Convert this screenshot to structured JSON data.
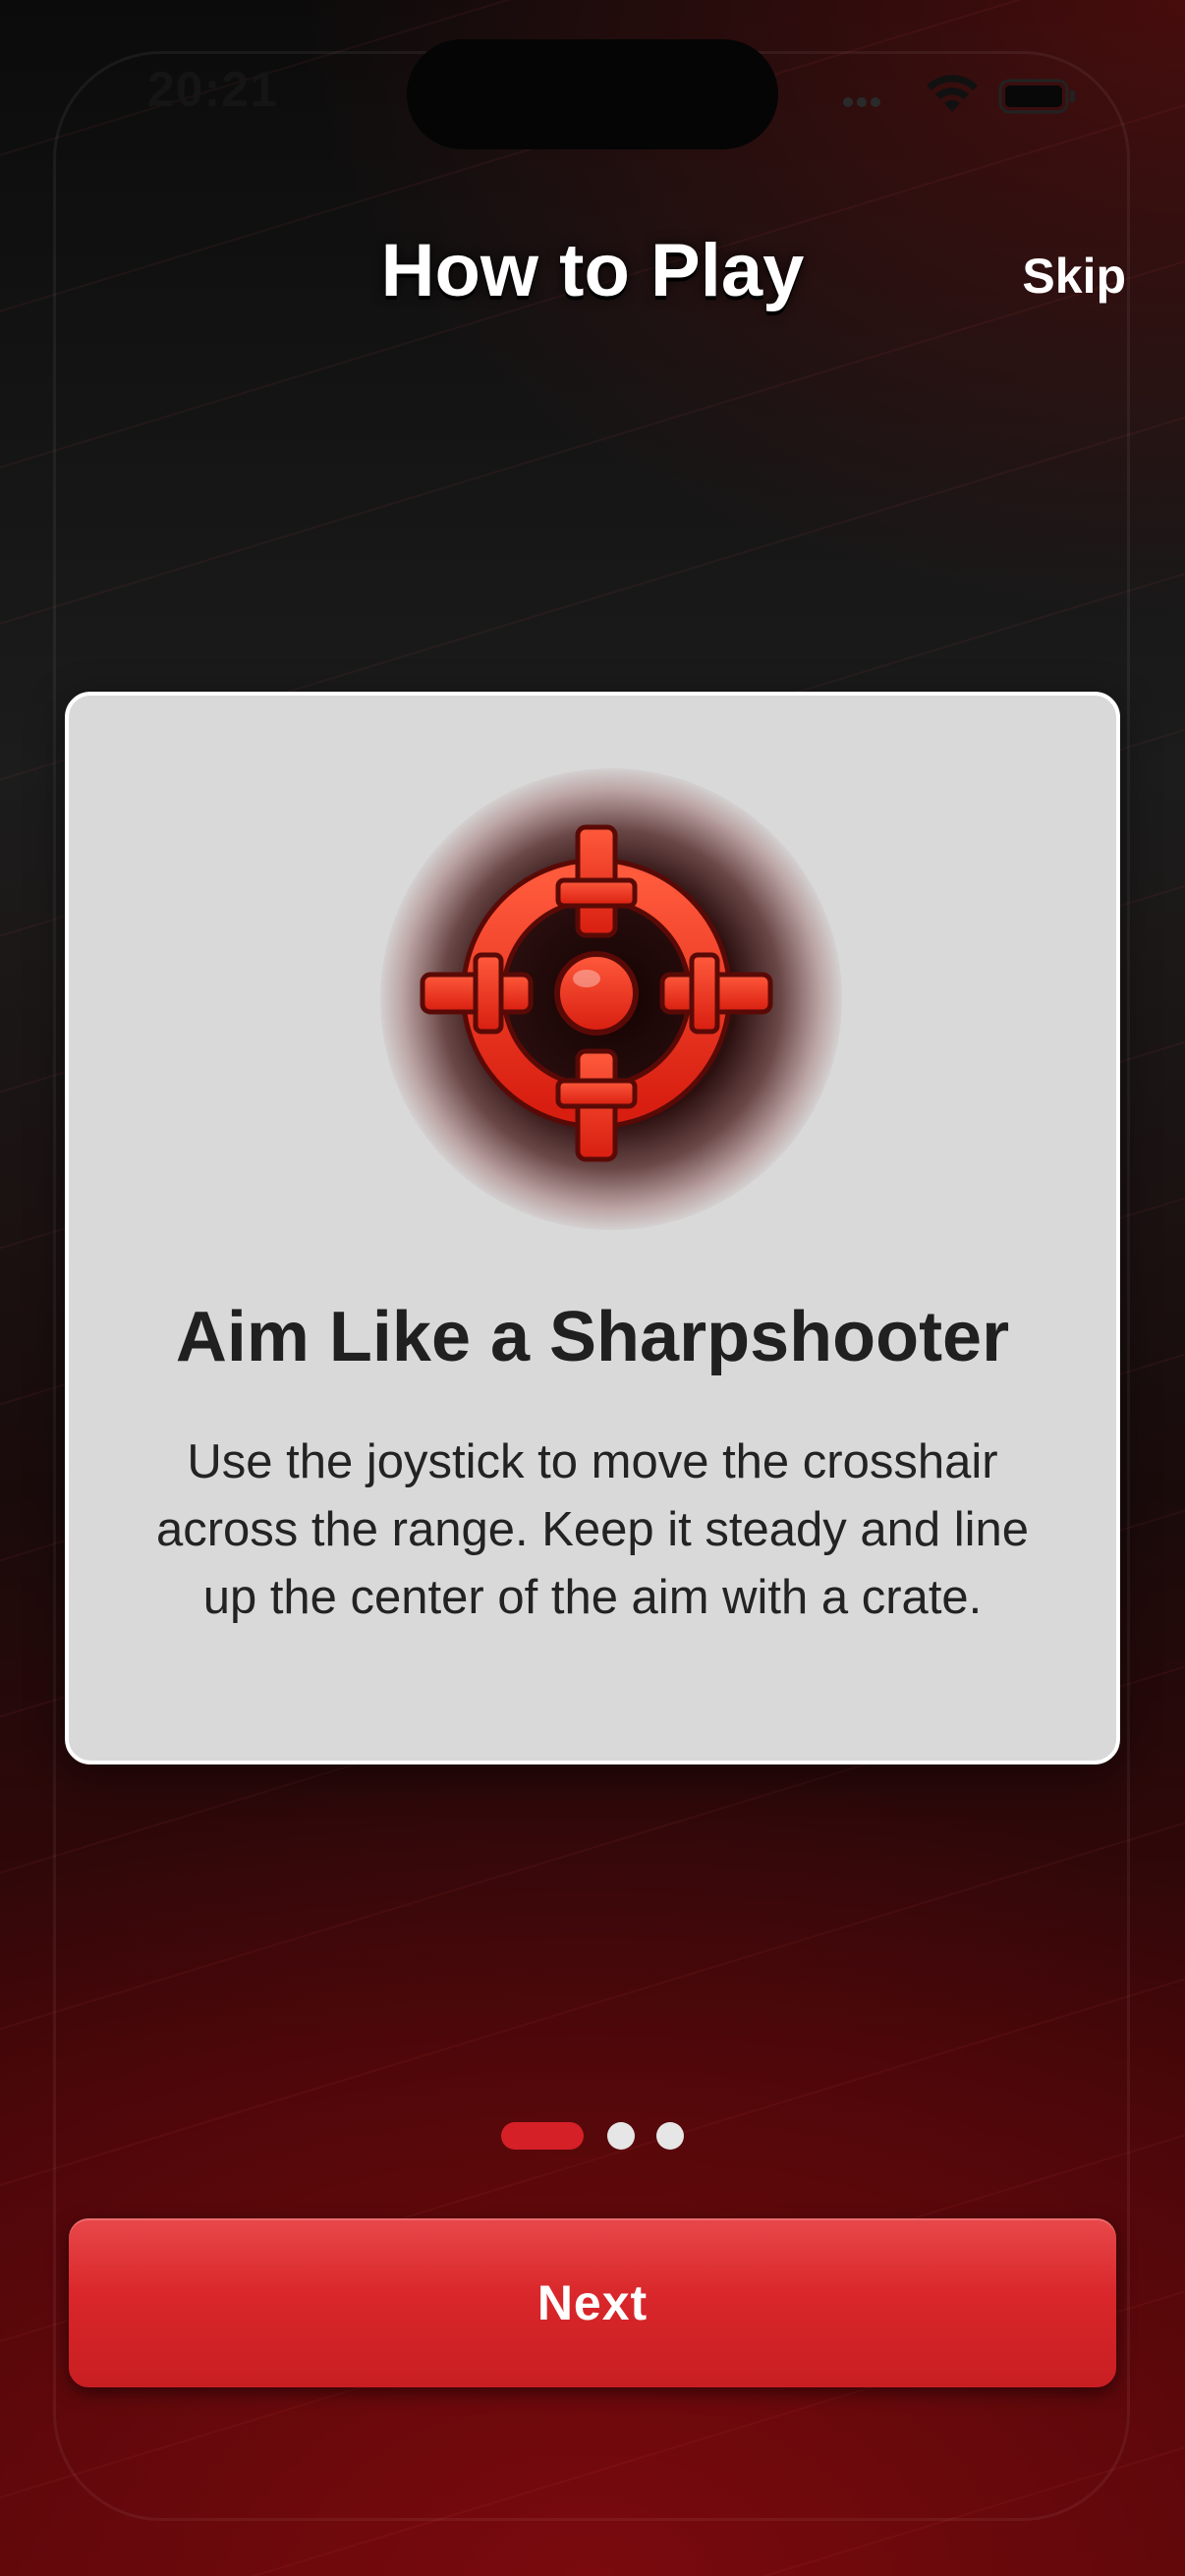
{
  "status_bar": {
    "time": "20:21"
  },
  "header": {
    "title": "How to Play",
    "skip_label": "Skip"
  },
  "card": {
    "icon": "crosshair-icon",
    "heading": "Aim Like a Sharpshooter",
    "body": "Use the joystick to move the crosshair across the range. Keep it steady and line up the center of the aim with a crate."
  },
  "pager": {
    "total_pages": 3,
    "current_page": 1
  },
  "footer": {
    "next_label": "Next"
  },
  "colors": {
    "accent": "#d42026",
    "card_background": "#d9d9d9",
    "crosshair": "#e8291d"
  }
}
